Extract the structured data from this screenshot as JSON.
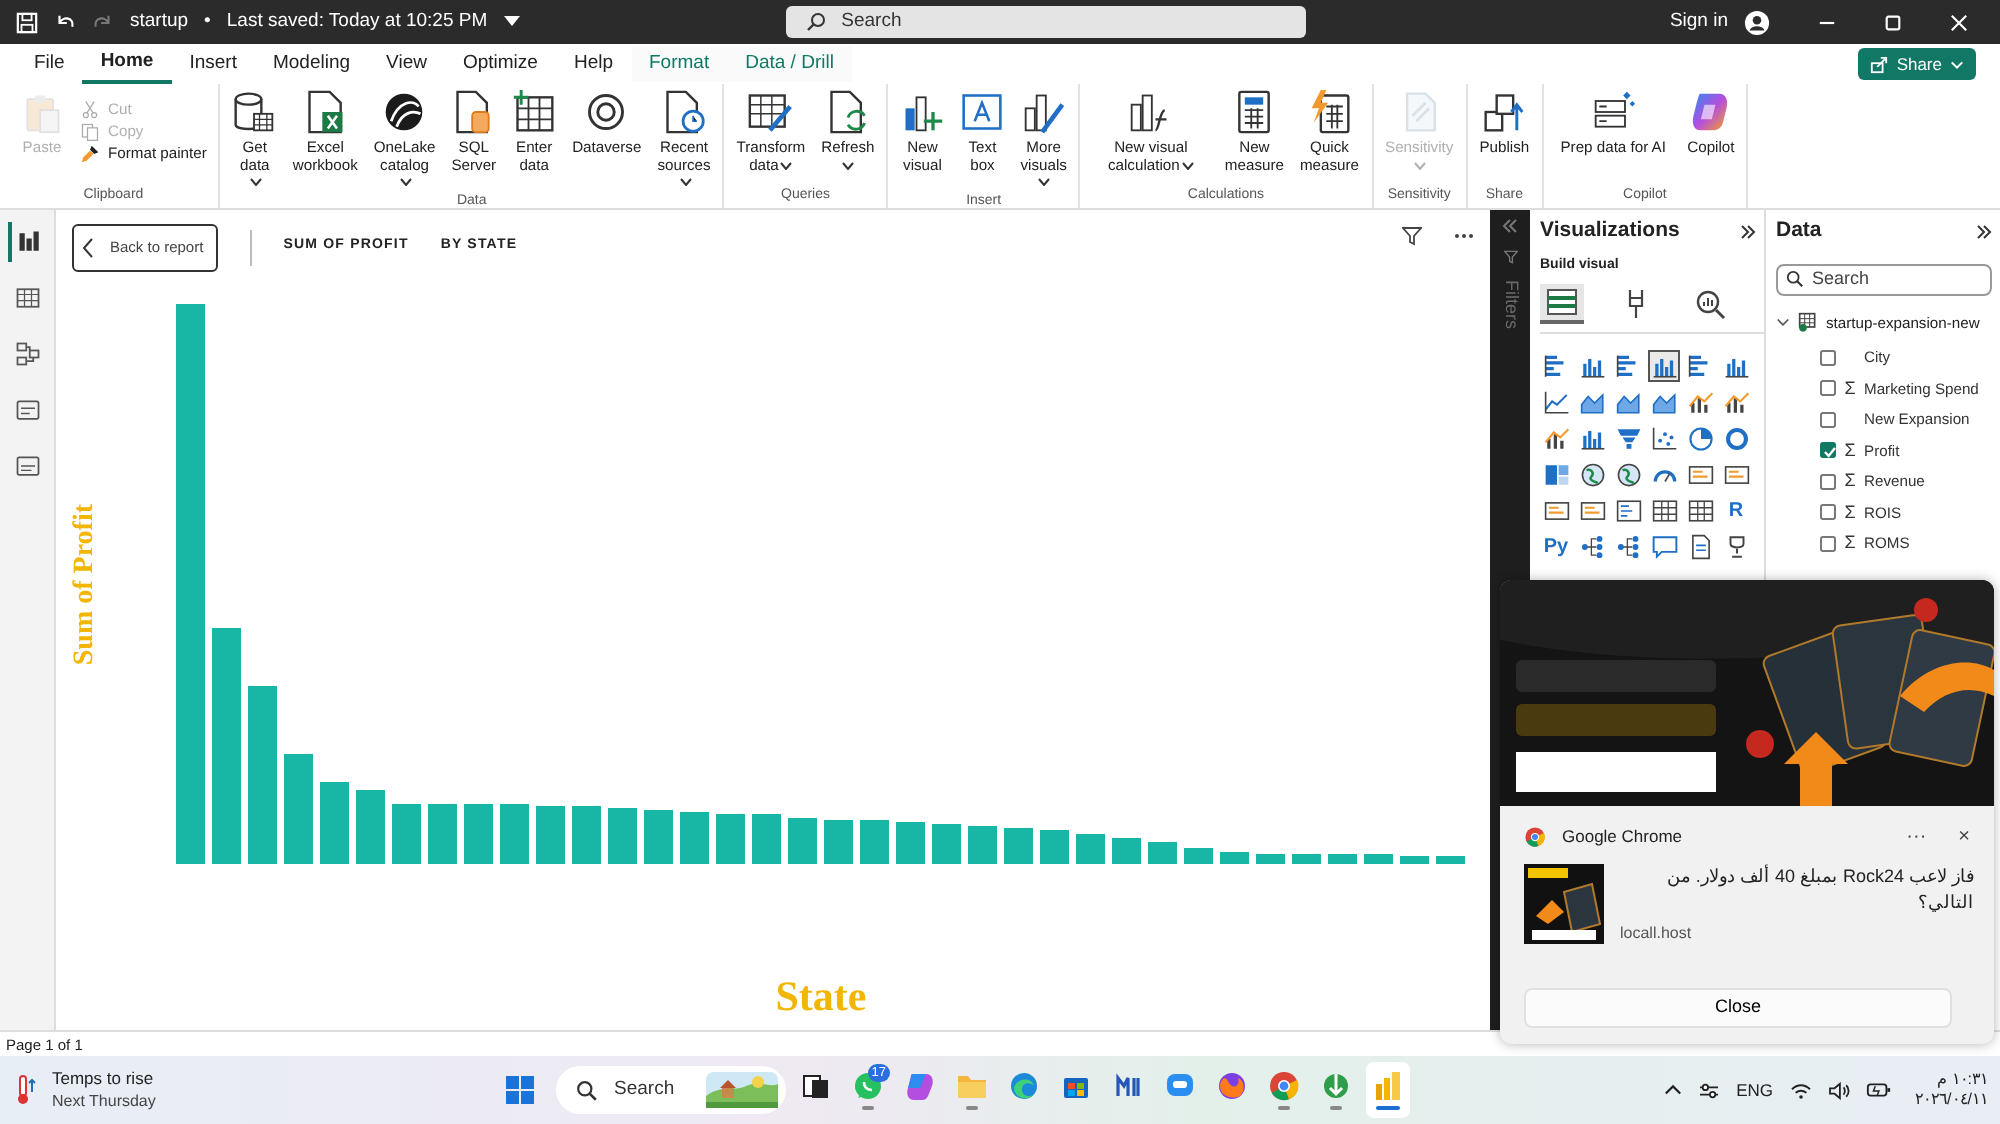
{
  "title_bar": {
    "document": "startup",
    "separator": "•",
    "saved": "Last saved: Today at 10:25 PM",
    "search": "Search",
    "sign_in": "Sign in"
  },
  "menu_tabs": [
    {
      "label": "File",
      "selected": false,
      "kind": "normal"
    },
    {
      "label": "Home",
      "selected": true,
      "kind": "normal"
    },
    {
      "label": "Insert",
      "selected": false,
      "kind": "normal"
    },
    {
      "label": "Modeling",
      "selected": false,
      "kind": "normal"
    },
    {
      "label": "View",
      "selected": false,
      "kind": "normal"
    },
    {
      "label": "Optimize",
      "selected": false,
      "kind": "normal"
    },
    {
      "label": "Help",
      "selected": false,
      "kind": "normal"
    },
    {
      "label": "Format",
      "selected": false,
      "kind": "contextual"
    },
    {
      "label": "Data / Drill",
      "selected": false,
      "kind": "contextual"
    }
  ],
  "share_button": "Share",
  "ribbon_groups": [
    {
      "label": "Clipboard",
      "buttons": [
        {
          "label": "Paste",
          "kind": "large",
          "disabled": true,
          "dropdown": false
        },
        {
          "label": "Cut",
          "kind": "small",
          "disabled": true,
          "dropdown": false
        },
        {
          "label": "Copy",
          "kind": "small",
          "disabled": true,
          "dropdown": false
        },
        {
          "label": "Format painter",
          "kind": "small",
          "disabled": false,
          "dropdown": false
        }
      ]
    },
    {
      "label": "Data",
      "buttons": [
        {
          "label": "Get data",
          "kind": "large",
          "disabled": false,
          "dropdown": true
        },
        {
          "label": "Excel workbook",
          "kind": "large",
          "disabled": false,
          "dropdown": false
        },
        {
          "label": "OneLake catalog",
          "kind": "large",
          "disabled": false,
          "dropdown": true
        },
        {
          "label": "SQL Server",
          "kind": "large",
          "disabled": false,
          "dropdown": false
        },
        {
          "label": "Enter data",
          "kind": "large",
          "disabled": false,
          "dropdown": false
        },
        {
          "label": "Dataverse",
          "kind": "large",
          "disabled": false,
          "dropdown": false
        },
        {
          "label": "Recent sources",
          "kind": "large",
          "disabled": false,
          "dropdown": true
        }
      ]
    },
    {
      "label": "Queries",
      "buttons": [
        {
          "label": "Transform data",
          "kind": "large",
          "disabled": false,
          "dropdown": true
        },
        {
          "label": "Refresh",
          "kind": "large",
          "disabled": false,
          "dropdown": true
        }
      ]
    },
    {
      "label": "Insert",
      "buttons": [
        {
          "label": "New visual",
          "kind": "large",
          "disabled": false,
          "dropdown": false
        },
        {
          "label": "Text box",
          "kind": "large",
          "disabled": false,
          "dropdown": false
        },
        {
          "label": "More visuals",
          "kind": "large",
          "disabled": false,
          "dropdown": true
        }
      ]
    },
    {
      "label": "Calculations",
      "buttons": [
        {
          "label": "New visual calculation",
          "kind": "large",
          "disabled": false,
          "dropdown": true
        },
        {
          "label": "New measure",
          "kind": "large",
          "disabled": false,
          "dropdown": false
        },
        {
          "label": "Quick measure",
          "kind": "large",
          "disabled": false,
          "dropdown": false
        }
      ]
    },
    {
      "label": "Sensitivity",
      "buttons": [
        {
          "label": "Sensitivity",
          "kind": "large",
          "disabled": true,
          "dropdown": true
        }
      ]
    },
    {
      "label": "Share",
      "buttons": [
        {
          "label": "Publish",
          "kind": "large",
          "disabled": false,
          "dropdown": false
        }
      ]
    },
    {
      "label": "Copilot",
      "buttons": [
        {
          "label": "Prep data for AI",
          "kind": "large",
          "disabled": false,
          "dropdown": false
        },
        {
          "label": "Copilot",
          "kind": "large",
          "disabled": false,
          "dropdown": false
        }
      ]
    }
  ],
  "view_rail": [
    {
      "selected": true
    },
    {
      "selected": false
    },
    {
      "selected": false
    },
    {
      "selected": false
    },
    {
      "selected": false
    }
  ],
  "report_header": {
    "back": "Back to report",
    "title": "SUM OF PROFIT",
    "subtitle": "BY STATE"
  },
  "chart": {
    "y_title": "Sum of Profit",
    "x_title": "State"
  },
  "filters_pane": {
    "label": "Filters"
  },
  "visualizations": {
    "title": "Visualizations",
    "subtitle": "Build visual",
    "build_tabs": [
      {
        "selected": true
      },
      {
        "selected": false
      },
      {
        "selected": false
      }
    ],
    "visual_types": [
      {
        "kind": "icon",
        "selected": false
      },
      {
        "kind": "icon",
        "selected": false
      },
      {
        "kind": "icon",
        "selected": false
      },
      {
        "kind": "icon",
        "selected": true
      },
      {
        "kind": "icon",
        "selected": false
      },
      {
        "kind": "icon",
        "selected": false
      },
      {
        "kind": "icon",
        "selected": false
      },
      {
        "kind": "icon",
        "selected": false
      },
      {
        "kind": "icon",
        "selected": false
      },
      {
        "kind": "icon",
        "selected": false
      },
      {
        "kind": "icon",
        "selected": false
      },
      {
        "kind": "icon",
        "selected": false
      },
      {
        "kind": "icon",
        "selected": false
      },
      {
        "kind": "icon",
        "selected": false
      },
      {
        "kind": "icon",
        "selected": false
      },
      {
        "kind": "icon",
        "selected": false
      },
      {
        "kind": "icon",
        "selected": false
      },
      {
        "kind": "icon",
        "selected": false
      },
      {
        "kind": "icon",
        "selected": false
      },
      {
        "kind": "icon",
        "selected": false
      },
      {
        "kind": "icon",
        "selected": false
      },
      {
        "kind": "icon",
        "selected": false
      },
      {
        "kind": "icon",
        "selected": false
      },
      {
        "kind": "icon",
        "selected": false
      },
      {
        "kind": "icon",
        "selected": false
      },
      {
        "kind": "icon",
        "selected": false
      },
      {
        "kind": "icon",
        "selected": false
      },
      {
        "kind": "icon",
        "selected": false
      },
      {
        "kind": "icon",
        "selected": false
      },
      {
        "kind": "text",
        "label": "R",
        "selected": false
      },
      {
        "kind": "text",
        "label": "Py",
        "selected": false
      },
      {
        "kind": "icon",
        "selected": false
      },
      {
        "kind": "icon",
        "selected": false
      },
      {
        "kind": "icon",
        "selected": false
      },
      {
        "kind": "icon",
        "selected": false
      },
      {
        "kind": "icon",
        "selected": false
      }
    ]
  },
  "data_pane": {
    "title": "Data",
    "search": "Search",
    "table": "startup-expansion-new",
    "expanded": true,
    "fields": [
      {
        "label": "City",
        "checked": false
      },
      {
        "label": "Marketing Spend",
        "symbol": "Σ",
        "checked": false
      },
      {
        "label": "New Expansion",
        "checked": false
      },
      {
        "label": "Profit",
        "symbol": "Σ",
        "checked": true
      },
      {
        "label": "Revenue",
        "symbol": "Σ",
        "checked": false
      },
      {
        "label": "ROIS",
        "symbol": "Σ",
        "checked": false
      },
      {
        "label": "ROMS",
        "symbol": "Σ",
        "checked": false
      }
    ]
  },
  "status_bar": {
    "page": "Page 1 of 1"
  },
  "notification": {
    "app": "Google Chrome",
    "more": "···",
    "dismiss": "×",
    "message": "فاز لاعب Rock24 بمبلغ 40 ألف دولار. من التالي؟",
    "source": "locall.host",
    "close": "Close"
  },
  "taskbar": {
    "weather": {
      "title": "Temps to rise",
      "subtitle": "Next Thursday"
    },
    "search": "Search",
    "apps": [
      {
        "running": false,
        "selected": false
      },
      {
        "running": true,
        "selected": false,
        "badge": "17"
      },
      {
        "running": false,
        "selected": false
      },
      {
        "running": true,
        "selected": false
      },
      {
        "running": false,
        "selected": false
      },
      {
        "running": false,
        "selected": false
      },
      {
        "running": false,
        "selected": false
      },
      {
        "running": false,
        "selected": false
      },
      {
        "running": false,
        "selected": false
      },
      {
        "running": true,
        "selected": false
      },
      {
        "running": true,
        "selected": false
      },
      {
        "running": true,
        "selected": true
      }
    ],
    "language": "ENG",
    "time": "١٠:٣١ م",
    "date": "٢٠٢٦/٠٤/١١"
  }
}
